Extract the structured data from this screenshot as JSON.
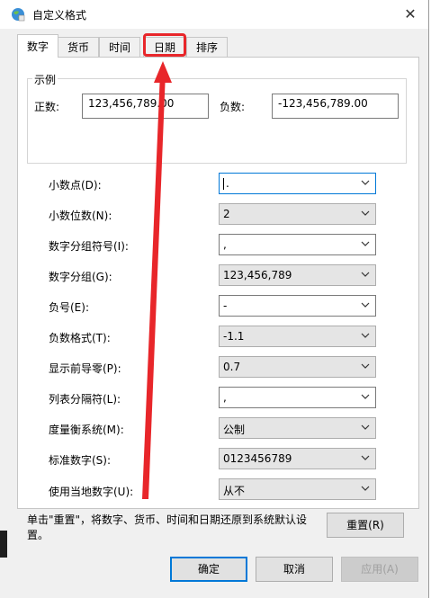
{
  "title": "自定义格式",
  "tabs": [
    {
      "label": "数字",
      "active": true
    },
    {
      "label": "货币",
      "active": false
    },
    {
      "label": "时间",
      "active": false
    },
    {
      "label": "日期",
      "active": false,
      "highlighted": true
    },
    {
      "label": "排序",
      "active": false
    }
  ],
  "sample": {
    "group_label": "示例",
    "positive_label": "正数:",
    "positive_value": "123,456,789.00",
    "negative_label": "负数:",
    "negative_value": "-123,456,789.00"
  },
  "settings": [
    {
      "label": "小数点(D):",
      "value": ".",
      "kind": "edit"
    },
    {
      "label": "小数位数(N):",
      "value": "2",
      "kind": "list"
    },
    {
      "label": "数字分组符号(I):",
      "value": ",",
      "kind": "edit"
    },
    {
      "label": "数字分组(G):",
      "value": "123,456,789",
      "kind": "list"
    },
    {
      "label": "负号(E):",
      "value": "-",
      "kind": "edit"
    },
    {
      "label": "负数格式(T):",
      "value": "-1.1",
      "kind": "list"
    },
    {
      "label": "显示前导零(P):",
      "value": "0.7",
      "kind": "list"
    },
    {
      "label": "列表分隔符(L):",
      "value": ",",
      "kind": "edit"
    },
    {
      "label": "度量衡系统(M):",
      "value": "公制",
      "kind": "list"
    },
    {
      "label": "标准数字(S):",
      "value": "0123456789",
      "kind": "list"
    },
    {
      "label": "使用当地数字(U):",
      "value": "从不",
      "kind": "list"
    }
  ],
  "reset_note": "单击\"重置\"，将数字、货币、时间和日期还原到系统默认设置。",
  "buttons": {
    "reset": "重置(R)",
    "ok": "确定",
    "cancel": "取消",
    "apply": "应用(A)"
  },
  "colors": {
    "annotation": "#e8262a",
    "focus": "#0078d7"
  }
}
